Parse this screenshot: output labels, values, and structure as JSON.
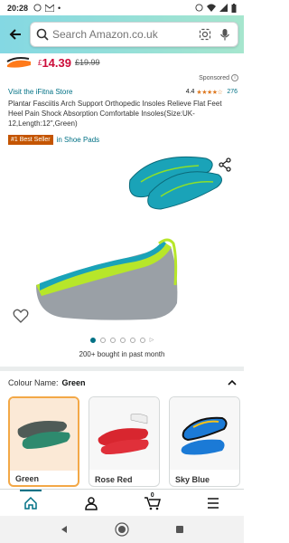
{
  "status_bar": {
    "time": "20:28"
  },
  "search": {
    "placeholder": "Search Amazon.co.uk"
  },
  "price_strip": {
    "currency": "£",
    "price": "14.39",
    "was_price": "£19.99"
  },
  "sponsored": {
    "label": "Sponsored"
  },
  "product": {
    "store_link": "Visit the iFitna Store",
    "rating_value": "4.4",
    "rating_stars": 4.4,
    "rating_count": "276",
    "title": "Plantar Fasciitis Arch Support Orthopedic Insoles Relieve Flat Feet Heel Pain Shock Absorption Comfortable Insoles(Size:UK-12,Length:12\",Green)",
    "badge": "#1 Best Seller",
    "badge_category": "in Shoe Pads"
  },
  "gallery": {
    "total_images": 6,
    "active_index": 0,
    "bought_text": "200+ bought in past month"
  },
  "colour": {
    "label": "Colour Name:",
    "selected": "Green",
    "options": [
      {
        "name": "Green"
      },
      {
        "name": "Rose Red"
      },
      {
        "name": "Sky Blue"
      }
    ]
  },
  "bottom_nav": {
    "cart_count": "0"
  },
  "colors": {
    "accent": "#007185",
    "price": "#cc0c39",
    "badge": "#c45500",
    "star": "#de7921",
    "header_start": "#84d8e3",
    "header_end": "#a6e6ce"
  },
  "icons": {
    "back": "arrow-left-icon",
    "camera": "camera-icon",
    "mic": "mic-icon",
    "share": "share-icon",
    "wishlist": "heart-icon",
    "home": "home-icon",
    "account": "person-icon",
    "cart": "cart-icon",
    "menu": "menu-icon"
  }
}
